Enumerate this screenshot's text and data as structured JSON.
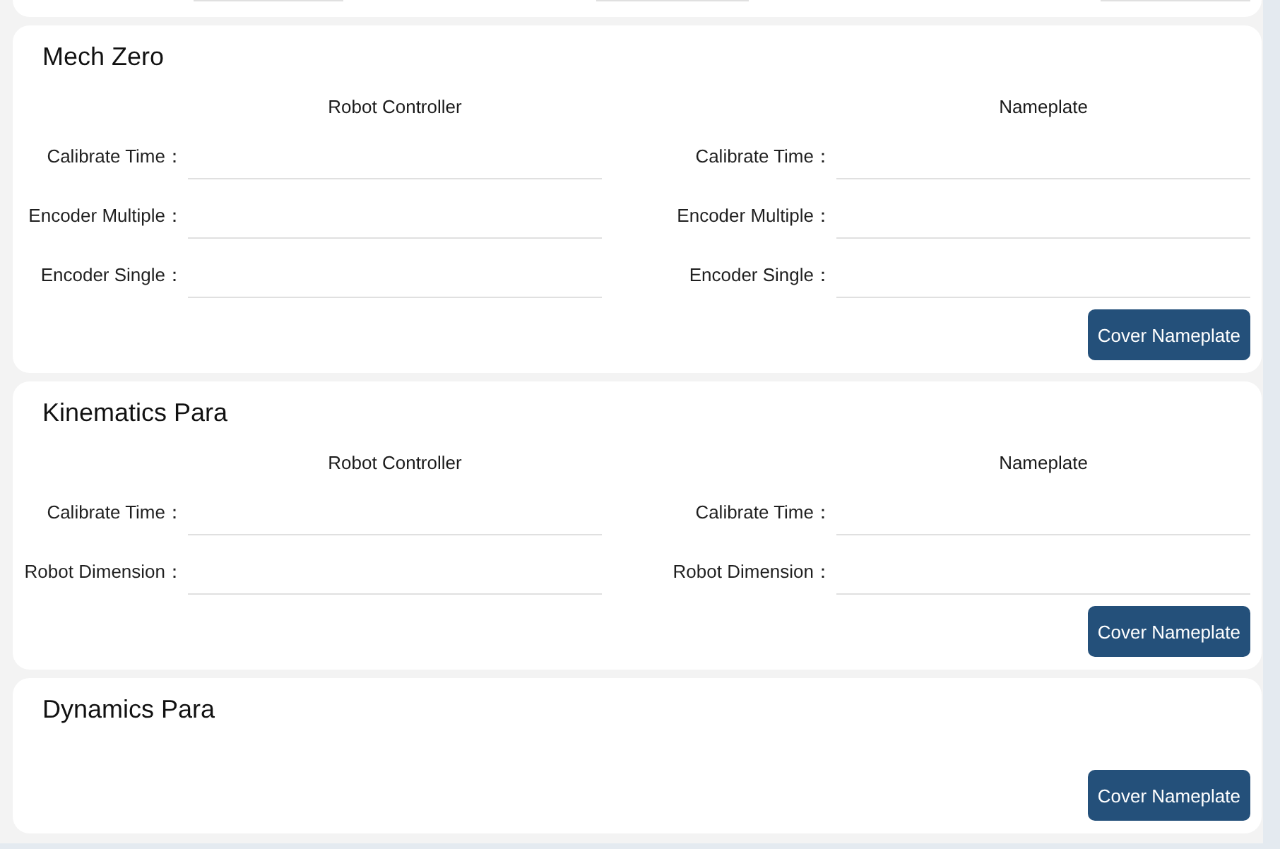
{
  "partial_card": {
    "fields": [
      {
        "kind": "input"
      },
      {
        "kind": "input"
      },
      {
        "kind": "input"
      }
    ]
  },
  "cards": [
    {
      "title": "Mech Zero",
      "sections": [
        {
          "heading": "Robot Controller",
          "fields": [
            {
              "label": "Calibrate Time："
            },
            {
              "label": "Encoder Multiple："
            },
            {
              "label": "Encoder Single："
            }
          ]
        },
        {
          "heading": "Nameplate",
          "fields": [
            {
              "label": "Calibrate Time："
            },
            {
              "label": "Encoder Multiple："
            },
            {
              "label": "Encoder Single："
            }
          ]
        }
      ],
      "button": "Cover Nameplate"
    },
    {
      "title": "Kinematics Para",
      "sections": [
        {
          "heading": "Robot Controller",
          "fields": [
            {
              "label": "Calibrate Time："
            },
            {
              "label": "Robot Dimension："
            }
          ]
        },
        {
          "heading": "Nameplate",
          "fields": [
            {
              "label": "Calibrate Time："
            },
            {
              "label": "Robot Dimension："
            }
          ]
        }
      ],
      "button": "Cover Nameplate"
    },
    {
      "title": "Dynamics Para",
      "button": "Cover Nameplate"
    }
  ]
}
